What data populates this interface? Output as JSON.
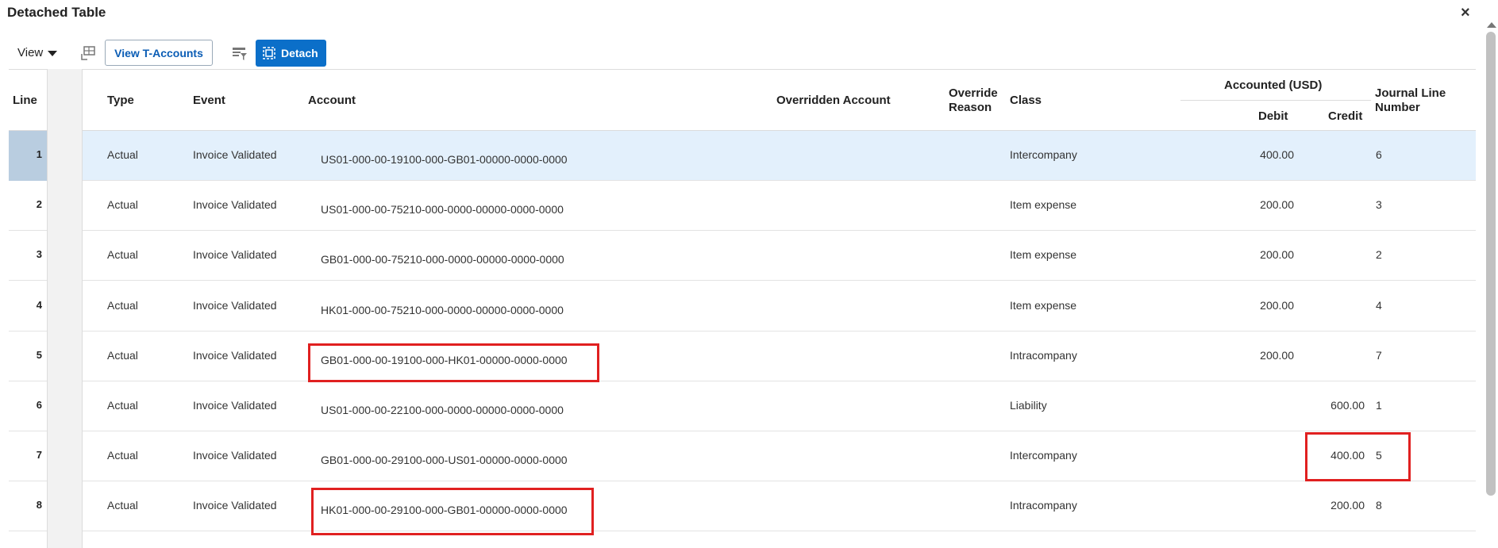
{
  "window": {
    "title": "Detached Table",
    "close_label": "×"
  },
  "toolbar": {
    "view_label": "View",
    "t_accounts_label": "View T-Accounts",
    "detach_label": "Detach"
  },
  "columns": {
    "line": "Line",
    "type": "Type",
    "event": "Event",
    "account": "Account",
    "overridden_account": "Overridden Account",
    "override_reason_1": "Override",
    "override_reason_2": "Reason",
    "class": "Class",
    "accounted_group": "Accounted (USD)",
    "debit": "Debit",
    "credit": "Credit",
    "journal_line_1": "Journal Line",
    "journal_line_2": "Number"
  },
  "rows": [
    {
      "line": "1",
      "type": "Actual",
      "event": "Invoice Validated",
      "account": "US01-000-00-19100-000-GB01-00000-0000-0000",
      "class": "Intercompany",
      "debit": "400.00",
      "credit": "",
      "journal_line": "6"
    },
    {
      "line": "2",
      "type": "Actual",
      "event": "Invoice Validated",
      "account": "US01-000-00-75210-000-0000-00000-0000-0000",
      "class": "Item expense",
      "debit": "200.00",
      "credit": "",
      "journal_line": "3"
    },
    {
      "line": "3",
      "type": "Actual",
      "event": "Invoice Validated",
      "account": "GB01-000-00-75210-000-0000-00000-0000-0000",
      "class": "Item expense",
      "debit": "200.00",
      "credit": "",
      "journal_line": "2"
    },
    {
      "line": "4",
      "type": "Actual",
      "event": "Invoice Validated",
      "account": "HK01-000-00-75210-000-0000-00000-0000-0000",
      "class": "Item expense",
      "debit": "200.00",
      "credit": "",
      "journal_line": "4"
    },
    {
      "line": "5",
      "type": "Actual",
      "event": "Invoice Validated",
      "account": "GB01-000-00-19100-000-HK01-00000-0000-0000",
      "class": "Intracompany",
      "debit": "200.00",
      "credit": "",
      "journal_line": "7"
    },
    {
      "line": "6",
      "type": "Actual",
      "event": "Invoice Validated",
      "account": "US01-000-00-22100-000-0000-00000-0000-0000",
      "class": "Liability",
      "debit": "",
      "credit": "600.00",
      "journal_line": "1"
    },
    {
      "line": "7",
      "type": "Actual",
      "event": "Invoice Validated",
      "account": "GB01-000-00-29100-000-US01-00000-0000-0000",
      "class": "Intercompany",
      "debit": "",
      "credit": "400.00",
      "journal_line": "5"
    },
    {
      "line": "8",
      "type": "Actual",
      "event": "Invoice Validated",
      "account": "HK01-000-00-29100-000-GB01-00000-0000-0000",
      "class": "Intracompany",
      "debit": "",
      "credit": "200.00",
      "journal_line": "8"
    }
  ],
  "icons": {
    "freeze": "freeze-columns-icon",
    "filter": "query-filter-icon",
    "detach": "detach-icon"
  },
  "colors": {
    "primary": "#0b6fc9",
    "link": "#0b5db5",
    "selected_row": "#e3f0fc",
    "highlight": "#e02020"
  }
}
